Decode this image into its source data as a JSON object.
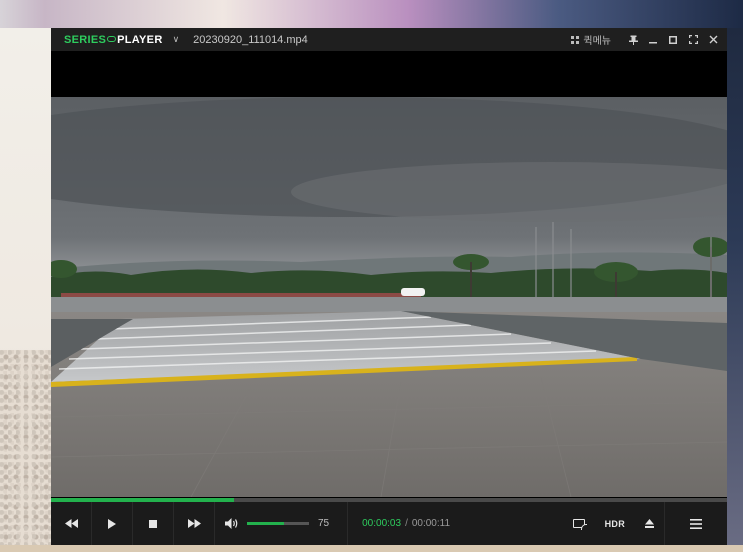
{
  "window": {
    "logo_part1": "SERIES",
    "logo_part2": "PLAYER",
    "filename": "20230920_111014.mp4",
    "quick_menu_label": "퀵메뉴"
  },
  "icons": {
    "dropdown": "chevron-down-icon",
    "quick_menu": "grid-icon",
    "pin": "pin-icon",
    "minimize": "minimize-icon",
    "maximize": "maximize-icon",
    "fullscreen": "fullscreen-icon",
    "close": "close-icon",
    "rewind": "rewind-icon",
    "play": "play-icon",
    "stop": "stop-icon",
    "fast_forward": "fast-forward-icon",
    "volume": "volume-icon",
    "cast": "cast-icon",
    "eject": "eject-icon",
    "menu": "menu-icon"
  },
  "playback": {
    "progress_fraction": 0.27,
    "current_time": "00:00:03",
    "separator": "/",
    "total_time": "00:00:11"
  },
  "volume": {
    "value": "75",
    "fraction": 0.6
  },
  "controls": {
    "hdr_label": "HDR"
  },
  "colors": {
    "accent": "#23b14d",
    "titlebar": "#1f1f1f",
    "controlbar": "#1b1b1b"
  }
}
